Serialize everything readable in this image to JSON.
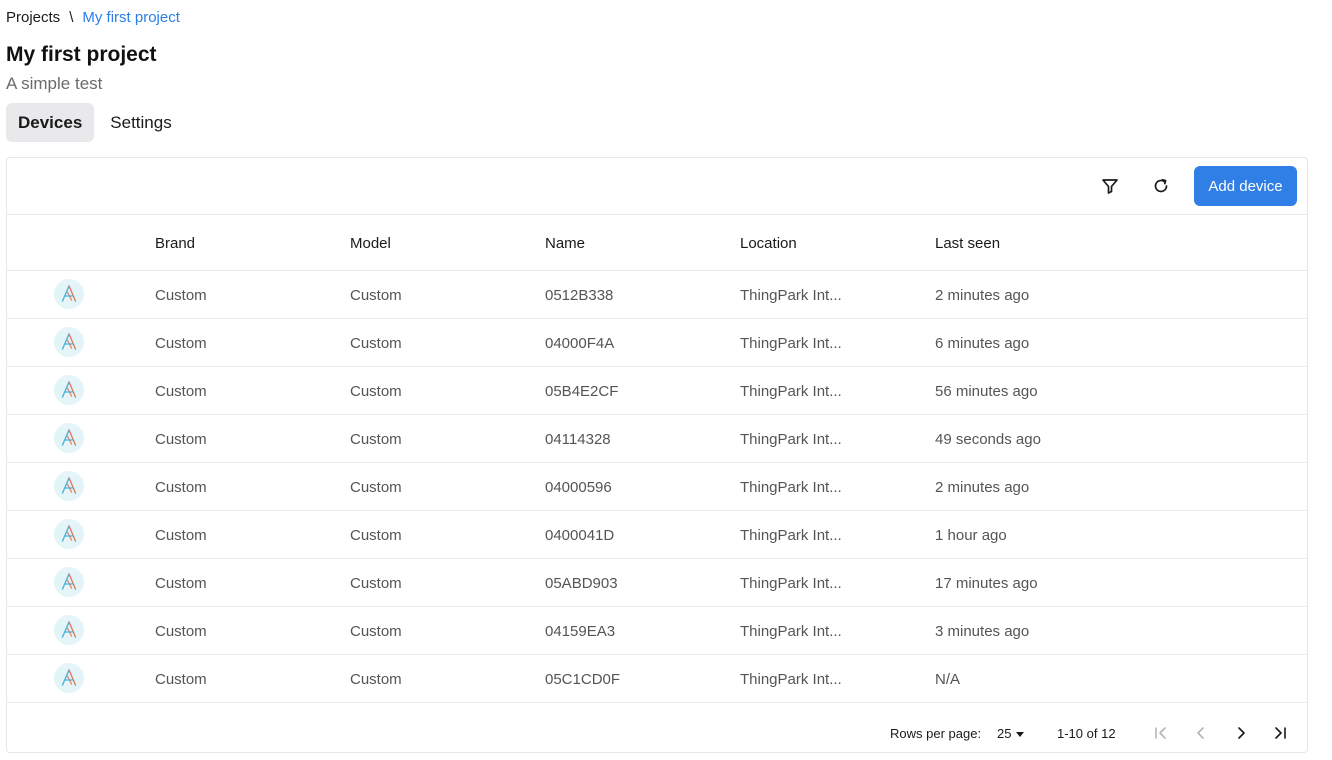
{
  "breadcrumb": {
    "root": "Projects",
    "separator": "\\",
    "current": "My first project"
  },
  "project": {
    "title": "My first project",
    "subtitle": "A simple test"
  },
  "tabs": [
    {
      "label": "Devices",
      "active": true
    },
    {
      "label": "Settings",
      "active": false
    }
  ],
  "toolbar": {
    "filter_icon": "filter-icon",
    "refresh_icon": "refresh-icon",
    "add_label": "Add device",
    "add_color": "#2f7fe6"
  },
  "columns": {
    "brand": "Brand",
    "model": "Model",
    "name": "Name",
    "location": "Location",
    "last_seen": "Last seen"
  },
  "rows": [
    {
      "brand": "Custom",
      "model": "Custom",
      "name": "0512B338",
      "location": "ThingPark Int...",
      "last_seen": "2 minutes ago"
    },
    {
      "brand": "Custom",
      "model": "Custom",
      "name": "04000F4A",
      "location": "ThingPark Int...",
      "last_seen": "6 minutes ago"
    },
    {
      "brand": "Custom",
      "model": "Custom",
      "name": "05B4E2CF",
      "location": "ThingPark Int...",
      "last_seen": "56 minutes ago"
    },
    {
      "brand": "Custom",
      "model": "Custom",
      "name": "04114328",
      "location": "ThingPark Int...",
      "last_seen": "49 seconds ago"
    },
    {
      "brand": "Custom",
      "model": "Custom",
      "name": "04000596",
      "location": "ThingPark Int...",
      "last_seen": "2 minutes ago"
    },
    {
      "brand": "Custom",
      "model": "Custom",
      "name": "0400041D",
      "location": "ThingPark Int...",
      "last_seen": "1 hour ago"
    },
    {
      "brand": "Custom",
      "model": "Custom",
      "name": "05ABD903",
      "location": "ThingPark Int...",
      "last_seen": "17 minutes ago"
    },
    {
      "brand": "Custom",
      "model": "Custom",
      "name": "04159EA3",
      "location": "ThingPark Int...",
      "last_seen": "3 minutes ago"
    },
    {
      "brand": "Custom",
      "model": "Custom",
      "name": "05C1CD0F",
      "location": "ThingPark Int...",
      "last_seen": "N/A"
    }
  ],
  "pagination": {
    "rows_per_page_label": "Rows per page:",
    "rows_per_page": "25",
    "range": "1-10 of 12"
  }
}
